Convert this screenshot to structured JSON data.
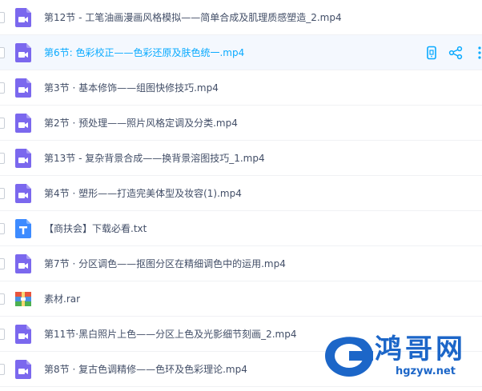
{
  "files": [
    {
      "name": "第12节 - 工笔油画漫画风格模拟——简单合成及肌理质感塑造_2.mp4",
      "type": "video",
      "hover": false
    },
    {
      "name": "第6节:  色彩校正——色彩还原及肤色统一.mp4",
      "type": "video",
      "hover": true
    },
    {
      "name": "第3节 · 基本修饰——组图快修技巧.mp4",
      "type": "video",
      "hover": false
    },
    {
      "name": "第2节 · 预处理——照片风格定调及分类.mp4",
      "type": "video",
      "hover": false
    },
    {
      "name": "第13节 - 复杂背景合成——换背景溶图技巧_1.mp4",
      "type": "video",
      "hover": false
    },
    {
      "name": "第4节 · 塑形——打造完美体型及妆容(1).mp4",
      "type": "video",
      "hover": false
    },
    {
      "name": "【商扶会】下载必看.txt",
      "type": "text",
      "hover": false
    },
    {
      "name": "第7节 · 分区调色——抠图分区在精细调色中的运用.mp4",
      "type": "video",
      "hover": false
    },
    {
      "name": "素材.rar",
      "type": "archive",
      "hover": false
    },
    {
      "name": "第11节·黑白照片上色——分区上色及光影细节刻画_2.mp4",
      "type": "video",
      "hover": false
    },
    {
      "name": "第8节 · 复古色调精修——色环及色彩理论.mp4",
      "type": "video",
      "hover": false
    }
  ],
  "row_actions": [
    "phone-icon",
    "share-icon",
    "more-icon"
  ],
  "watermark": {
    "text": "鸿哥网",
    "url": "hgzyw.net"
  },
  "colors": {
    "video": "#7b68ee",
    "text": "#3d8bff",
    "accent": "#09aaff",
    "name": "#424e67"
  }
}
